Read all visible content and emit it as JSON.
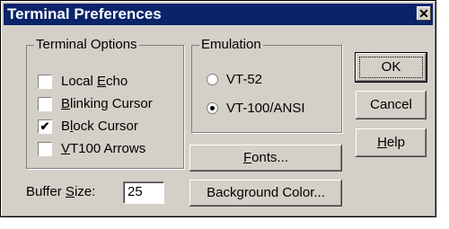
{
  "window": {
    "title": "Terminal Preferences",
    "close_glyph": "✕"
  },
  "terminal_options": {
    "legend": "Terminal Options",
    "items": [
      {
        "pre": "Local ",
        "accel": "E",
        "post": "cho",
        "checked": false
      },
      {
        "pre": "",
        "accel": "B",
        "post": "linking Cursor",
        "checked": false
      },
      {
        "pre": "B",
        "accel": "l",
        "post": "ock Cursor",
        "checked": true
      },
      {
        "pre": "",
        "accel": "V",
        "post": "T100 Arrows",
        "checked": false
      }
    ]
  },
  "emulation": {
    "legend": "Emulation",
    "options": [
      {
        "label": "VT-52",
        "selected": false
      },
      {
        "label": "VT-100/ANSI",
        "selected": true
      }
    ]
  },
  "buffer": {
    "pre": "Buffer ",
    "accel": "S",
    "post": "ize:",
    "value": "25"
  },
  "buttons": {
    "ok": "OK",
    "cancel": "Cancel",
    "help_accel": "H",
    "help_rest": "elp",
    "fonts_accel": "F",
    "fonts_rest": "onts...",
    "bg_pre": "Back",
    "bg_accel": "g",
    "bg_post": "round Color..."
  }
}
